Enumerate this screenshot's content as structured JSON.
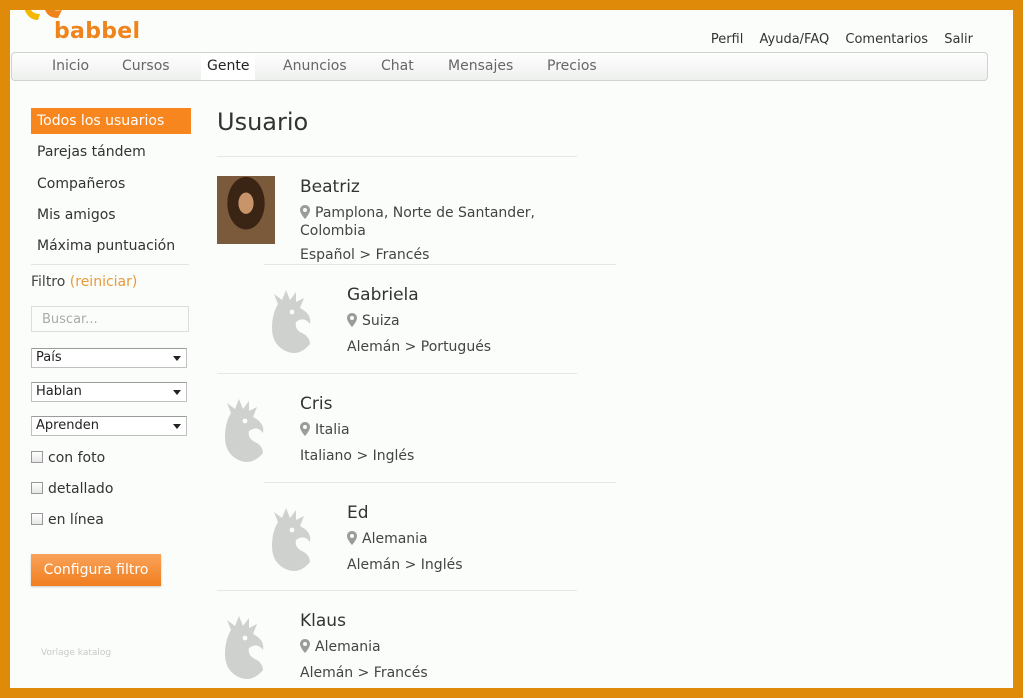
{
  "brand": {
    "name": "babbel",
    "accent": "#f7861f"
  },
  "top_links": [
    "Perfil",
    "Ayuda/FAQ",
    "Comentarios",
    "Salir"
  ],
  "nav": {
    "items": [
      "Inicio",
      "Cursos",
      "Gente",
      "Anuncios",
      "Chat",
      "Mensajes",
      "Precios"
    ],
    "active": "Gente"
  },
  "sidebar": {
    "items": [
      "Todos los usuarios",
      "Parejas tándem",
      "Compañeros",
      "Mis amigos",
      "Máxima puntuación"
    ],
    "active": "Todos los usuarios",
    "filter_label": "Filtro",
    "filter_reset": "(reiniciar)",
    "search_placeholder": "Buscar...",
    "selects": [
      "País",
      "Hablan",
      "Aprenden"
    ],
    "checkboxes": [
      "con foto",
      "detallado",
      "en línea"
    ],
    "filter_button": "Configura filtro"
  },
  "watermark": "Vorlage katalog",
  "page_title": "Usuario",
  "users": [
    {
      "name": "Beatriz",
      "location": "Pamplona, Norte de Santander, Colombia",
      "languages": "Español > Francés",
      "has_photo": true
    },
    {
      "name": "Gabriela",
      "location": "Suiza",
      "languages": "Alemán > Portugués",
      "has_photo": false
    },
    {
      "name": "Cris",
      "location": "Italia",
      "languages": "Italiano > Inglés",
      "has_photo": false
    },
    {
      "name": "Ed",
      "location": "Alemania",
      "languages": "Alemán > Inglés",
      "has_photo": false
    },
    {
      "name": "Klaus",
      "location": "Alemania",
      "languages": "Alemán > Francés",
      "has_photo": false
    }
  ]
}
